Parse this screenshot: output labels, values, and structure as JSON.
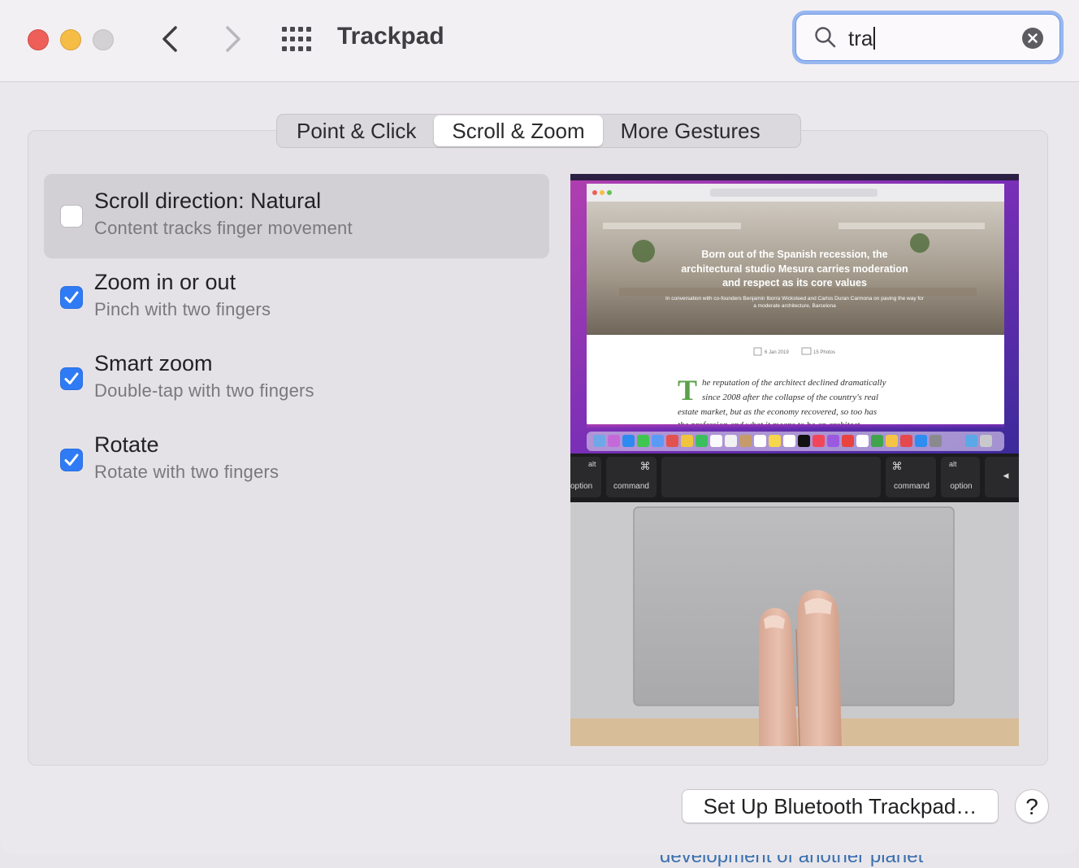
{
  "window": {
    "title": "Trackpad"
  },
  "search": {
    "value": "tra"
  },
  "tabs": [
    {
      "label": "Point & Click",
      "active": false
    },
    {
      "label": "Scroll & Zoom",
      "active": true
    },
    {
      "label": "More Gestures",
      "active": false
    }
  ],
  "options": [
    {
      "title": "Scroll direction: Natural",
      "subtitle": "Content tracks finger movement",
      "checked": false,
      "selected": true
    },
    {
      "title": "Zoom in or out",
      "subtitle": "Pinch with two fingers",
      "checked": true,
      "selected": false
    },
    {
      "title": "Smart zoom",
      "subtitle": "Double-tap with two fingers",
      "checked": true,
      "selected": false
    },
    {
      "title": "Rotate",
      "subtitle": "Rotate with two fingers",
      "checked": true,
      "selected": false
    }
  ],
  "preview": {
    "headline_lines": [
      "Born out of the Spanish recession, the",
      "architectural studio Mesura carries moderation",
      "and respect as its core values"
    ],
    "byline_lines": [
      "In conversation with co-founders Benjamin Iborra Wicksteed and Carlos Duran Carmona on paving the way for",
      "a moderate architecture, Barcelona"
    ],
    "date": "6 Jan 2019",
    "photos": "15 Photos",
    "drop_cap": "T",
    "body_lines": [
      "he reputation of the architect declined dramatically",
      "since 2008 after the collapse of the country's real",
      "estate market, but as the economy recovered, so too has",
      "the profession and what it means to be an architect"
    ],
    "keys": [
      {
        "symbol": "alt",
        "label": "option"
      },
      {
        "symbol": "⌘",
        "label": "command"
      },
      {
        "symbol": "⌘",
        "label": "command"
      },
      {
        "symbol": "alt",
        "label": "option"
      },
      {
        "symbol": "◀",
        "label": ""
      }
    ]
  },
  "buttons": {
    "setup": "Set Up Bluetooth Trackpad…",
    "help": "?"
  },
  "background": {
    "partial_text": "development of another planet"
  },
  "colors": {
    "accent": "#2f7bf5",
    "focus_ring": "#98b7ef",
    "close": "#ed5f58",
    "minimize": "#f5bd45"
  }
}
